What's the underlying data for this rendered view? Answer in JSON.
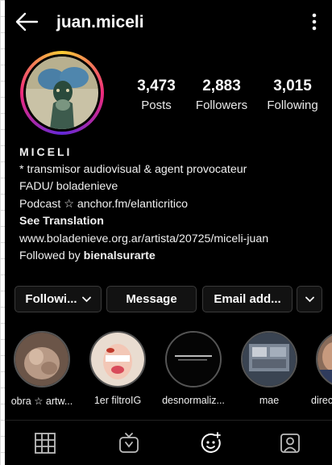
{
  "header": {
    "username": "juan.miceli"
  },
  "stats": {
    "posts_count": "3,473",
    "posts_label": "Posts",
    "followers_count": "2,883",
    "followers_label": "Followers",
    "following_count": "3,015",
    "following_label": "Following"
  },
  "bio": {
    "name": "MICELI",
    "line1": "* transmisor audiovisual & agent provocateur",
    "line2": "FADU/ boladenieve",
    "line3": "Podcast ☆ anchor.fm/elanticritico",
    "see_translation": "See Translation",
    "link": "www.boladenieve.org.ar/artista/20725/miceli-juan",
    "followed_by_prefix": "Followed by",
    "followed_by_user": "bienalsurarte"
  },
  "actions": {
    "following_label": "Followi...",
    "message_label": "Message",
    "email_label": "Email add..."
  },
  "highlights": [
    {
      "label": "obra ☆ artw..."
    },
    {
      "label": "1er filtroIG"
    },
    {
      "label": "desnormaliz..."
    },
    {
      "label": "mae"
    },
    {
      "label": "direc"
    }
  ],
  "icons": {
    "back": "arrow-left-icon",
    "more": "vertical-dots-icon",
    "grid": "grid-icon",
    "reels": "igtv-icon",
    "effects": "face-effects-icon",
    "tagged": "tagged-person-icon"
  },
  "colors": {
    "background": "#000000",
    "button": "#121212",
    "text": "#fafafa",
    "story_ring_start": "#f9ce34",
    "story_ring_mid": "#ee2a7b"
  }
}
